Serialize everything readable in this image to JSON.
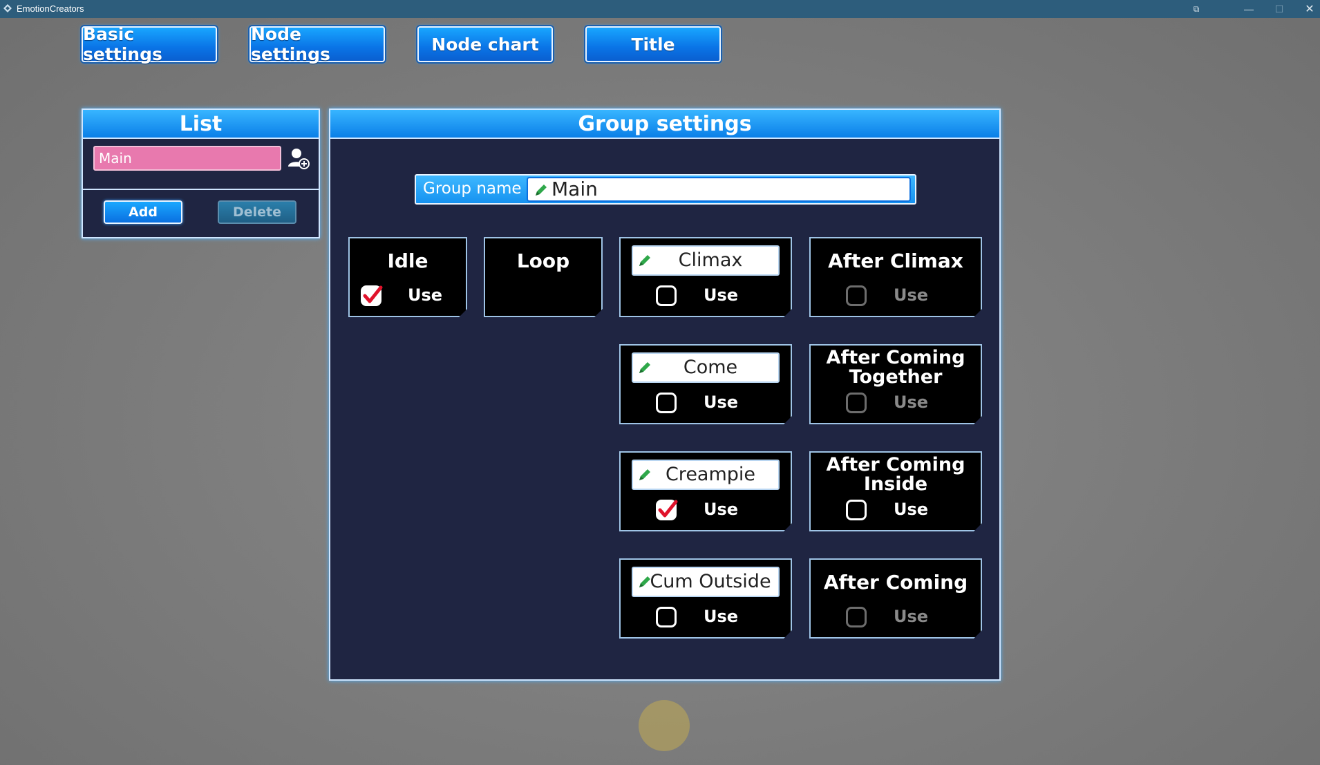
{
  "window": {
    "title": "EmotionCreators",
    "icons": [
      "app-icon",
      "restore-icon",
      "minimize-icon",
      "maximize-icon",
      "close-icon"
    ]
  },
  "nav": {
    "basic_settings": "Basic settings",
    "node_settings": "Node settings",
    "node_chart": "Node chart",
    "title": "Title"
  },
  "list_panel": {
    "header": "List",
    "items": [
      {
        "label": "Main",
        "selected": true
      }
    ],
    "add_label": "Add",
    "delete_label": "Delete",
    "add_user_icon": "add-user-icon"
  },
  "group_panel": {
    "header": "Group settings",
    "group_name_label": "Group name",
    "group_name_value": "Main",
    "use_label": "Use",
    "cards": {
      "idle": {
        "title": "Idle",
        "checked": true,
        "enabled": true
      },
      "loop": {
        "title": "Loop"
      },
      "climax": {
        "title": "Climax",
        "editable": true,
        "checked": false,
        "enabled": true
      },
      "after_climax": {
        "title": "After Climax",
        "checked": false,
        "enabled": false
      },
      "come": {
        "title": "Come",
        "editable": true,
        "checked": false,
        "enabled": true
      },
      "after_coming_together": {
        "title": "After Coming Together",
        "checked": false,
        "enabled": false
      },
      "creampie": {
        "title": "Creampie",
        "editable": true,
        "checked": true,
        "enabled": true
      },
      "after_coming_inside": {
        "title": "After Coming Inside",
        "checked": false,
        "enabled": true
      },
      "cum_outside": {
        "title": "Cum Outside",
        "editable": true,
        "checked": false,
        "enabled": true
      },
      "after_coming": {
        "title": "After Coming",
        "checked": false,
        "enabled": false
      }
    }
  },
  "colors": {
    "accent_blue": "#0a7fe8",
    "panel_bg": "#1f2542",
    "list_item_pink": "#e879ae",
    "check_red": "#e0122b",
    "pencil_green": "#2fa84a"
  }
}
